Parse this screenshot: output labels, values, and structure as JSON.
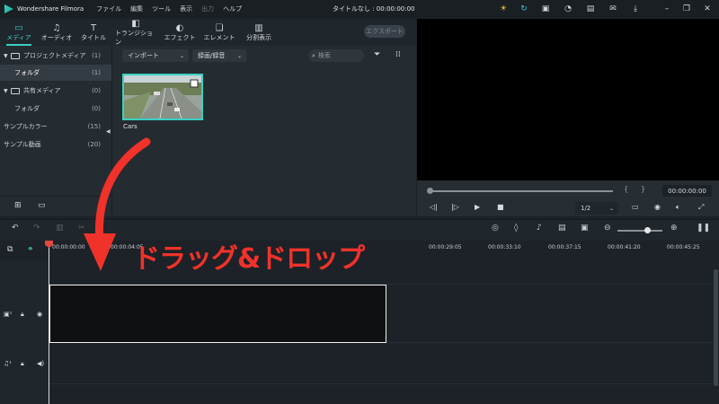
{
  "titlebar": {
    "app_name": "Wondershare Filmora",
    "menus": [
      "ファイル",
      "編集",
      "ツール",
      "表示",
      "出力",
      "ヘルプ"
    ],
    "document_title": "タイトルなし : 00:00:00:00"
  },
  "tabs": [
    {
      "label": "メディア",
      "icon": "folder-icon"
    },
    {
      "label": "オーディオ",
      "icon": "music-note-icon"
    },
    {
      "label": "タイトル",
      "icon": "text-icon"
    },
    {
      "label": "トランジション",
      "icon": "transition-icon"
    },
    {
      "label": "エフェクト",
      "icon": "effects-icon"
    },
    {
      "label": "エレメント",
      "icon": "elements-icon"
    },
    {
      "label": "分割表示",
      "icon": "split-screen-icon"
    }
  ],
  "export_label": "エクスポート",
  "tree": [
    {
      "label": "プロジェクトメディア",
      "count": "(1)"
    },
    {
      "label": "フォルダ",
      "count": "(1)"
    },
    {
      "label": "共有メディア",
      "count": "(0)"
    },
    {
      "label": "フォルダ",
      "count": "(0)"
    },
    {
      "label": "サンプルカラー",
      "count": "(15)"
    },
    {
      "label": "サンプル動画",
      "count": "(20)"
    }
  ],
  "media_toolbar": {
    "import_label": "インポート",
    "record_label": "録画/録音",
    "search_placeholder": "検索"
  },
  "clip": {
    "label": "Cars"
  },
  "preview": {
    "timecode": "00:00:00:00",
    "ratio": "1/2"
  },
  "ruler_ticks": [
    "00:00:00:00",
    "00:00:04:05",
    "00:00:29:05",
    "00:00:33:10",
    "00:00:37:15",
    "00:00:41:20",
    "00:00:45:25"
  ],
  "annotation": "ドラッグ&ドロップ",
  "colors": {
    "accent": "#3ad0c2",
    "annotation": "#f0322a"
  }
}
